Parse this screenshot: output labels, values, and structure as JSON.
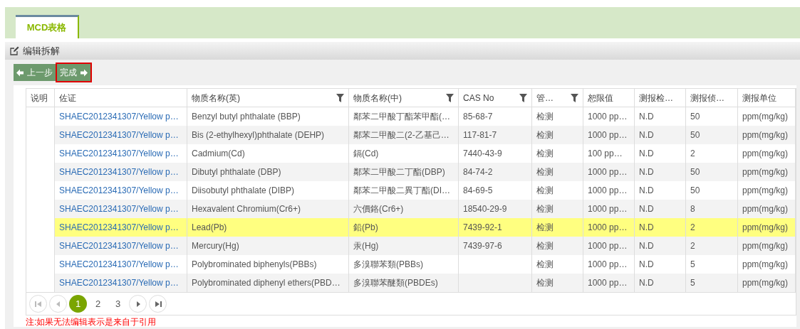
{
  "tabs": [
    {
      "label": "MCD表格",
      "selected": true
    }
  ],
  "panel_title": "编辑拆解",
  "buttons": [
    {
      "label": "上一步",
      "kind": "back",
      "highlighted": false
    },
    {
      "label": "完成",
      "kind": "forward",
      "highlighted": true
    }
  ],
  "table": {
    "columns": [
      {
        "label": "说明",
        "filter": false
      },
      {
        "label": "佐证",
        "filter": false
      },
      {
        "label": "物质名称(英)",
        "filter": true
      },
      {
        "label": "物质名称(中)",
        "filter": true
      },
      {
        "label": "CAS No",
        "filter": true
      },
      {
        "label": "管…",
        "filter": true
      },
      {
        "label": "恕限值",
        "filter": false
      },
      {
        "label": "测报检…",
        "filter": false
      },
      {
        "label": "测报侦…",
        "filter": false
      },
      {
        "label": "测报单位",
        "filter": false
      }
    ],
    "rows": [
      {
        "selected": false,
        "cells": [
          "",
          "SHAEC2012341307/Yellow p…",
          "Benzyl butyl phthalate (BBP)",
          "鄰苯二甲酸丁酯苯甲酯(…",
          "85-68-7",
          "检测",
          "1000 pp…",
          "N.D",
          "50",
          "ppm(mg/kg)"
        ]
      },
      {
        "selected": false,
        "cells": [
          "",
          "SHAEC2012341307/Yellow p…",
          "Bis (2-ethylhexyl)phthalate (DEHP)",
          "鄰苯二甲酸二(2-乙基己…",
          "117-81-7",
          "检测",
          "1000 pp…",
          "N.D",
          "50",
          "ppm(mg/kg)"
        ]
      },
      {
        "selected": false,
        "cells": [
          "",
          "SHAEC2012341307/Yellow p…",
          "Cadmium(Cd)",
          "鎘(Cd)",
          "7440-43-9",
          "检测",
          "100 pp…",
          "N.D",
          "2",
          "ppm(mg/kg)"
        ]
      },
      {
        "selected": false,
        "cells": [
          "",
          "SHAEC2012341307/Yellow p…",
          "Dibutyl phthalate (DBP)",
          "鄰苯二甲酸二丁酯(DBP)",
          "84-74-2",
          "检测",
          "1000 pp…",
          "N.D",
          "50",
          "ppm(mg/kg)"
        ]
      },
      {
        "selected": false,
        "cells": [
          "",
          "SHAEC2012341307/Yellow p…",
          "Diisobutyl phthalate (DIBP)",
          "鄰苯二甲酸二異丁酯(DI…",
          "84-69-5",
          "检测",
          "1000 pp…",
          "N.D",
          "50",
          "ppm(mg/kg)"
        ]
      },
      {
        "selected": false,
        "cells": [
          "",
          "SHAEC2012341307/Yellow p…",
          "Hexavalent Chromium(Cr6+)",
          "六價鉻(Cr6+)",
          "18540-29-9",
          "检测",
          "1000 pp…",
          "N.D",
          "8",
          "ppm(mg/kg)"
        ]
      },
      {
        "selected": true,
        "cells": [
          "",
          "SHAEC2012341307/Yellow p…",
          "Lead(Pb)",
          "鉛(Pb)",
          "7439-92-1",
          "检测",
          "1000 pp…",
          "N.D",
          "2",
          "ppm(mg/kg)"
        ]
      },
      {
        "selected": false,
        "cells": [
          "",
          "SHAEC2012341307/Yellow p…",
          "Mercury(Hg)",
          "汞(Hg)",
          "7439-97-6",
          "检测",
          "1000 pp…",
          "N.D",
          "2",
          "ppm(mg/kg)"
        ]
      },
      {
        "selected": false,
        "cells": [
          "",
          "SHAEC2012341307/Yellow p…",
          "Polybrominated biphenyls(PBBs)",
          "多溴聯苯類(PBBs)",
          "",
          "检测",
          "1000 pp…",
          "N.D",
          "5",
          "ppm(mg/kg)"
        ]
      },
      {
        "selected": false,
        "cells": [
          "",
          "SHAEC2012341307/Yellow p…",
          "Polybrominated diphenyl ethers(PBD…",
          "多溴聯苯醚類(PBDEs)",
          "",
          "检测",
          "1000 pp…",
          "N.D",
          "5",
          "ppm(mg/kg)"
        ]
      }
    ]
  },
  "pager": {
    "pages": [
      {
        "label": "1",
        "selected": true
      },
      {
        "label": "2",
        "selected": false
      },
      {
        "label": "3",
        "selected": false
      }
    ]
  },
  "note": "注:如果无法编辑表示是来自于引用"
}
